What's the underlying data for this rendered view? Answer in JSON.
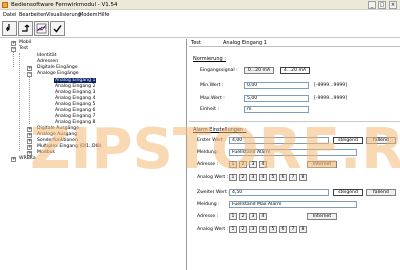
{
  "window": {
    "title": "Bediensoftware Fernwirkmodul - V1.54",
    "controls": [
      "_",
      "□",
      "×"
    ]
  },
  "menu": [
    "Datei",
    "Bearbeiten",
    "Visualisierung",
    "Modem",
    "Hilfe"
  ],
  "toolbar": {
    "buttons": [
      {
        "icon": "connect-arrow-icon"
      },
      {
        "icon": "transfer-arrow-icon"
      },
      {
        "icon": "chart-icon"
      },
      {
        "icon": "check-icon"
      }
    ]
  },
  "tree": {
    "root1": "Mobil",
    "root2": "Test",
    "items": {
      "identitaet": "Identität",
      "adressen": "Adressen",
      "digitale_eingaenge": "Digitale Eingänge",
      "analoge_eingaenge": "Analoge Eingänge",
      "ae1": "Analog Eingang 1",
      "ae2": "Analog Eingang 2",
      "ae3": "Analog Eingang 3",
      "ae4": "Analog Eingang 4",
      "ae5": "Analog Eingang 5",
      "ae6": "Analog Eingang 6",
      "ae7": "Analog Eingang 7",
      "ae8": "Analog Eingang 8",
      "digitale_ausgaenge": "Digitale Ausgänge",
      "analoge_ausgaenge": "Analoge Ausgang",
      "sonderfunktionen": "Sonderfunktionen",
      "multiplex": "Multiplex Eingang (DI1..DI8)",
      "modbus": "Modbus"
    },
    "root3": "WRBKa"
  },
  "header": {
    "left": "Test",
    "right": "Analog Eingang 1"
  },
  "normierung": {
    "heading": "Normierung :",
    "eingangssignal_label": "Eingangssignal :",
    "btn_0_20": "0...20 mA",
    "btn_4_20": "4...20 mA",
    "min_label": "Min.Wert :",
    "min_value": "0,00",
    "min_range": "[-9999...9999]",
    "max_label": "Max.Wert :",
    "max_value": "5,00",
    "max_range": "[-9999...9999]",
    "einheit_label": "Einheit :",
    "einheit_value": "m"
  },
  "alarm": {
    "heading": "Alarm Einstellungen :",
    "erster_label": "Erster Wert :",
    "erster_value": "4,00",
    "steigend": "steigend",
    "fallend": "fallend",
    "meldung_label": "Meldung :",
    "meldung1_value": "Fuellstand Alarm",
    "adresse_label": "Adresse :",
    "internet": "Internet",
    "analog_label": "Analog Wert :",
    "zweiter_label": "Zweiter Wert :",
    "zweiter_value": "4,50",
    "meldung2_value": "Fuellstand Max Alarm",
    "adresse_nums": [
      "1",
      "2",
      "3",
      "4"
    ],
    "analog_nums": [
      "1",
      "2",
      "3",
      "4",
      "5",
      "6",
      "7",
      "8"
    ]
  },
  "watermark": "ZIPSTORE.RU",
  "colors": {
    "selection": "#0a246a",
    "watermark": "#f4b877"
  }
}
